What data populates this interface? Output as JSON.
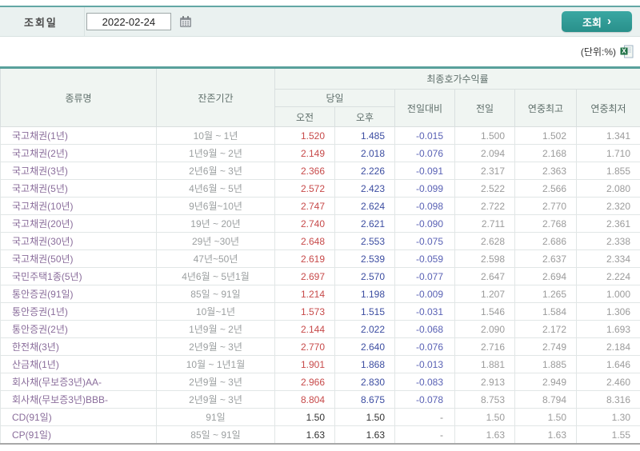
{
  "query": {
    "label": "조회일",
    "date": "2022-02-24",
    "button_label": "조회",
    "button_chevron": "›"
  },
  "unit_label": "(단위:%)",
  "colors": {
    "accent_teal": "#2f9d99",
    "header_bg": "#f0f5f2",
    "am_red": "#c74a4a",
    "pm_navy": "#3c4da1",
    "diff_blue": "#5a62b5",
    "name_purple": "#8a6d9b",
    "muted_gray": "#9b9b9b"
  },
  "table": {
    "headers": {
      "name": "종류명",
      "period": "잔존기간",
      "group": "최종호가수익률",
      "today": "당일",
      "am": "오전",
      "pm": "오후",
      "diff": "전일대비",
      "prev": "전일",
      "high": "연중최고",
      "low": "연중최저"
    },
    "rows": [
      {
        "name": "국고채권(1년)",
        "period": "10월 ~ 1년",
        "am": "1.520",
        "pm": "1.485",
        "diff": "-0.015",
        "prev": "1.500",
        "high": "1.502",
        "low": "1.341"
      },
      {
        "name": "국고채권(2년)",
        "period": "1년9월 ~ 2년",
        "am": "2.149",
        "pm": "2.018",
        "diff": "-0.076",
        "prev": "2.094",
        "high": "2.168",
        "low": "1.710"
      },
      {
        "name": "국고채권(3년)",
        "period": "2년6월 ~ 3년",
        "am": "2.366",
        "pm": "2.226",
        "diff": "-0.091",
        "prev": "2.317",
        "high": "2.363",
        "low": "1.855"
      },
      {
        "name": "국고채권(5년)",
        "period": "4년6월 ~ 5년",
        "am": "2.572",
        "pm": "2.423",
        "diff": "-0.099",
        "prev": "2.522",
        "high": "2.566",
        "low": "2.080"
      },
      {
        "name": "국고채권(10년)",
        "period": "9년6월~10년",
        "am": "2.747",
        "pm": "2.624",
        "diff": "-0.098",
        "prev": "2.722",
        "high": "2.770",
        "low": "2.320"
      },
      {
        "name": "국고채권(20년)",
        "period": "19년 ~ 20년",
        "am": "2.740",
        "pm": "2.621",
        "diff": "-0.090",
        "prev": "2.711",
        "high": "2.768",
        "low": "2.361"
      },
      {
        "name": "국고채권(30년)",
        "period": "29년 ~30년",
        "am": "2.648",
        "pm": "2.553",
        "diff": "-0.075",
        "prev": "2.628",
        "high": "2.686",
        "low": "2.338"
      },
      {
        "name": "국고채권(50년)",
        "period": "47년~50년",
        "am": "2.619",
        "pm": "2.539",
        "diff": "-0.059",
        "prev": "2.598",
        "high": "2.637",
        "low": "2.334"
      },
      {
        "name": "국민주택1종(5년)",
        "period": "4년6월 ~ 5년1월",
        "am": "2.697",
        "pm": "2.570",
        "diff": "-0.077",
        "prev": "2.647",
        "high": "2.694",
        "low": "2.224"
      },
      {
        "name": "통안증권(91일)",
        "period": "85일 ~ 91일",
        "am": "1.214",
        "pm": "1.198",
        "diff": "-0.009",
        "prev": "1.207",
        "high": "1.265",
        "low": "1.000"
      },
      {
        "name": "통안증권(1년)",
        "period": "10월~1년",
        "am": "1.573",
        "pm": "1.515",
        "diff": "-0.031",
        "prev": "1.546",
        "high": "1.584",
        "low": "1.306"
      },
      {
        "name": "통안증권(2년)",
        "period": "1년9월 ~ 2년",
        "am": "2.144",
        "pm": "2.022",
        "diff": "-0.068",
        "prev": "2.090",
        "high": "2.172",
        "low": "1.693"
      },
      {
        "name": "한전채(3년)",
        "period": "2년9월 ~ 3년",
        "am": "2.770",
        "pm": "2.640",
        "diff": "-0.076",
        "prev": "2.716",
        "high": "2.749",
        "low": "2.184"
      },
      {
        "name": "산금채(1년)",
        "period": "10월 ~ 1년1월",
        "am": "1.901",
        "pm": "1.868",
        "diff": "-0.013",
        "prev": "1.881",
        "high": "1.885",
        "low": "1.646"
      },
      {
        "name": "회사채(무보증3년)AA-",
        "period": "2년9월 ~ 3년",
        "am": "2.966",
        "pm": "2.830",
        "diff": "-0.083",
        "prev": "2.913",
        "high": "2.949",
        "low": "2.460"
      },
      {
        "name": "회사채(무보증3년)BBB-",
        "period": "2년9월 ~ 3년",
        "am": "8.804",
        "pm": "8.675",
        "diff": "-0.078",
        "prev": "8.753",
        "high": "8.794",
        "low": "8.316"
      },
      {
        "name": "CD(91일)",
        "period": "91일",
        "am": "1.50",
        "pm": "1.50",
        "diff": "-",
        "prev": "1.50",
        "high": "1.50",
        "low": "1.30"
      },
      {
        "name": "CP(91일)",
        "period": "85일 ~ 91일",
        "am": "1.63",
        "pm": "1.63",
        "diff": "-",
        "prev": "1.63",
        "high": "1.63",
        "low": "1.55"
      }
    ]
  }
}
